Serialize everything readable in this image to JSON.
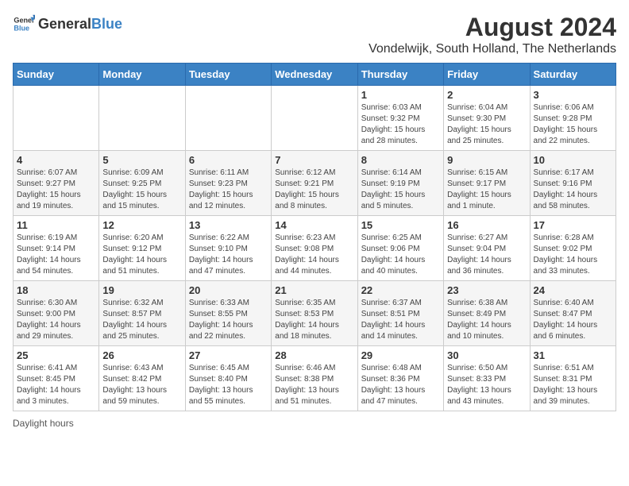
{
  "header": {
    "logo_general": "General",
    "logo_blue": "Blue",
    "main_title": "August 2024",
    "subtitle": "Vondelwijk, South Holland, The Netherlands"
  },
  "calendar": {
    "days_of_week": [
      "Sunday",
      "Monday",
      "Tuesday",
      "Wednesday",
      "Thursday",
      "Friday",
      "Saturday"
    ],
    "weeks": [
      [
        {
          "day": "",
          "info": ""
        },
        {
          "day": "",
          "info": ""
        },
        {
          "day": "",
          "info": ""
        },
        {
          "day": "",
          "info": ""
        },
        {
          "day": "1",
          "info": "Sunrise: 6:03 AM\nSunset: 9:32 PM\nDaylight: 15 hours\nand 28 minutes."
        },
        {
          "day": "2",
          "info": "Sunrise: 6:04 AM\nSunset: 9:30 PM\nDaylight: 15 hours\nand 25 minutes."
        },
        {
          "day": "3",
          "info": "Sunrise: 6:06 AM\nSunset: 9:28 PM\nDaylight: 15 hours\nand 22 minutes."
        }
      ],
      [
        {
          "day": "4",
          "info": "Sunrise: 6:07 AM\nSunset: 9:27 PM\nDaylight: 15 hours\nand 19 minutes."
        },
        {
          "day": "5",
          "info": "Sunrise: 6:09 AM\nSunset: 9:25 PM\nDaylight: 15 hours\nand 15 minutes."
        },
        {
          "day": "6",
          "info": "Sunrise: 6:11 AM\nSunset: 9:23 PM\nDaylight: 15 hours\nand 12 minutes."
        },
        {
          "day": "7",
          "info": "Sunrise: 6:12 AM\nSunset: 9:21 PM\nDaylight: 15 hours\nand 8 minutes."
        },
        {
          "day": "8",
          "info": "Sunrise: 6:14 AM\nSunset: 9:19 PM\nDaylight: 15 hours\nand 5 minutes."
        },
        {
          "day": "9",
          "info": "Sunrise: 6:15 AM\nSunset: 9:17 PM\nDaylight: 15 hours\nand 1 minute."
        },
        {
          "day": "10",
          "info": "Sunrise: 6:17 AM\nSunset: 9:16 PM\nDaylight: 14 hours\nand 58 minutes."
        }
      ],
      [
        {
          "day": "11",
          "info": "Sunrise: 6:19 AM\nSunset: 9:14 PM\nDaylight: 14 hours\nand 54 minutes."
        },
        {
          "day": "12",
          "info": "Sunrise: 6:20 AM\nSunset: 9:12 PM\nDaylight: 14 hours\nand 51 minutes."
        },
        {
          "day": "13",
          "info": "Sunrise: 6:22 AM\nSunset: 9:10 PM\nDaylight: 14 hours\nand 47 minutes."
        },
        {
          "day": "14",
          "info": "Sunrise: 6:23 AM\nSunset: 9:08 PM\nDaylight: 14 hours\nand 44 minutes."
        },
        {
          "day": "15",
          "info": "Sunrise: 6:25 AM\nSunset: 9:06 PM\nDaylight: 14 hours\nand 40 minutes."
        },
        {
          "day": "16",
          "info": "Sunrise: 6:27 AM\nSunset: 9:04 PM\nDaylight: 14 hours\nand 36 minutes."
        },
        {
          "day": "17",
          "info": "Sunrise: 6:28 AM\nSunset: 9:02 PM\nDaylight: 14 hours\nand 33 minutes."
        }
      ],
      [
        {
          "day": "18",
          "info": "Sunrise: 6:30 AM\nSunset: 9:00 PM\nDaylight: 14 hours\nand 29 minutes."
        },
        {
          "day": "19",
          "info": "Sunrise: 6:32 AM\nSunset: 8:57 PM\nDaylight: 14 hours\nand 25 minutes."
        },
        {
          "day": "20",
          "info": "Sunrise: 6:33 AM\nSunset: 8:55 PM\nDaylight: 14 hours\nand 22 minutes."
        },
        {
          "day": "21",
          "info": "Sunrise: 6:35 AM\nSunset: 8:53 PM\nDaylight: 14 hours\nand 18 minutes."
        },
        {
          "day": "22",
          "info": "Sunrise: 6:37 AM\nSunset: 8:51 PM\nDaylight: 14 hours\nand 14 minutes."
        },
        {
          "day": "23",
          "info": "Sunrise: 6:38 AM\nSunset: 8:49 PM\nDaylight: 14 hours\nand 10 minutes."
        },
        {
          "day": "24",
          "info": "Sunrise: 6:40 AM\nSunset: 8:47 PM\nDaylight: 14 hours\nand 6 minutes."
        }
      ],
      [
        {
          "day": "25",
          "info": "Sunrise: 6:41 AM\nSunset: 8:45 PM\nDaylight: 14 hours\nand 3 minutes."
        },
        {
          "day": "26",
          "info": "Sunrise: 6:43 AM\nSunset: 8:42 PM\nDaylight: 13 hours\nand 59 minutes."
        },
        {
          "day": "27",
          "info": "Sunrise: 6:45 AM\nSunset: 8:40 PM\nDaylight: 13 hours\nand 55 minutes."
        },
        {
          "day": "28",
          "info": "Sunrise: 6:46 AM\nSunset: 8:38 PM\nDaylight: 13 hours\nand 51 minutes."
        },
        {
          "day": "29",
          "info": "Sunrise: 6:48 AM\nSunset: 8:36 PM\nDaylight: 13 hours\nand 47 minutes."
        },
        {
          "day": "30",
          "info": "Sunrise: 6:50 AM\nSunset: 8:33 PM\nDaylight: 13 hours\nand 43 minutes."
        },
        {
          "day": "31",
          "info": "Sunrise: 6:51 AM\nSunset: 8:31 PM\nDaylight: 13 hours\nand 39 minutes."
        }
      ]
    ]
  },
  "footer": {
    "note": "Daylight hours"
  }
}
